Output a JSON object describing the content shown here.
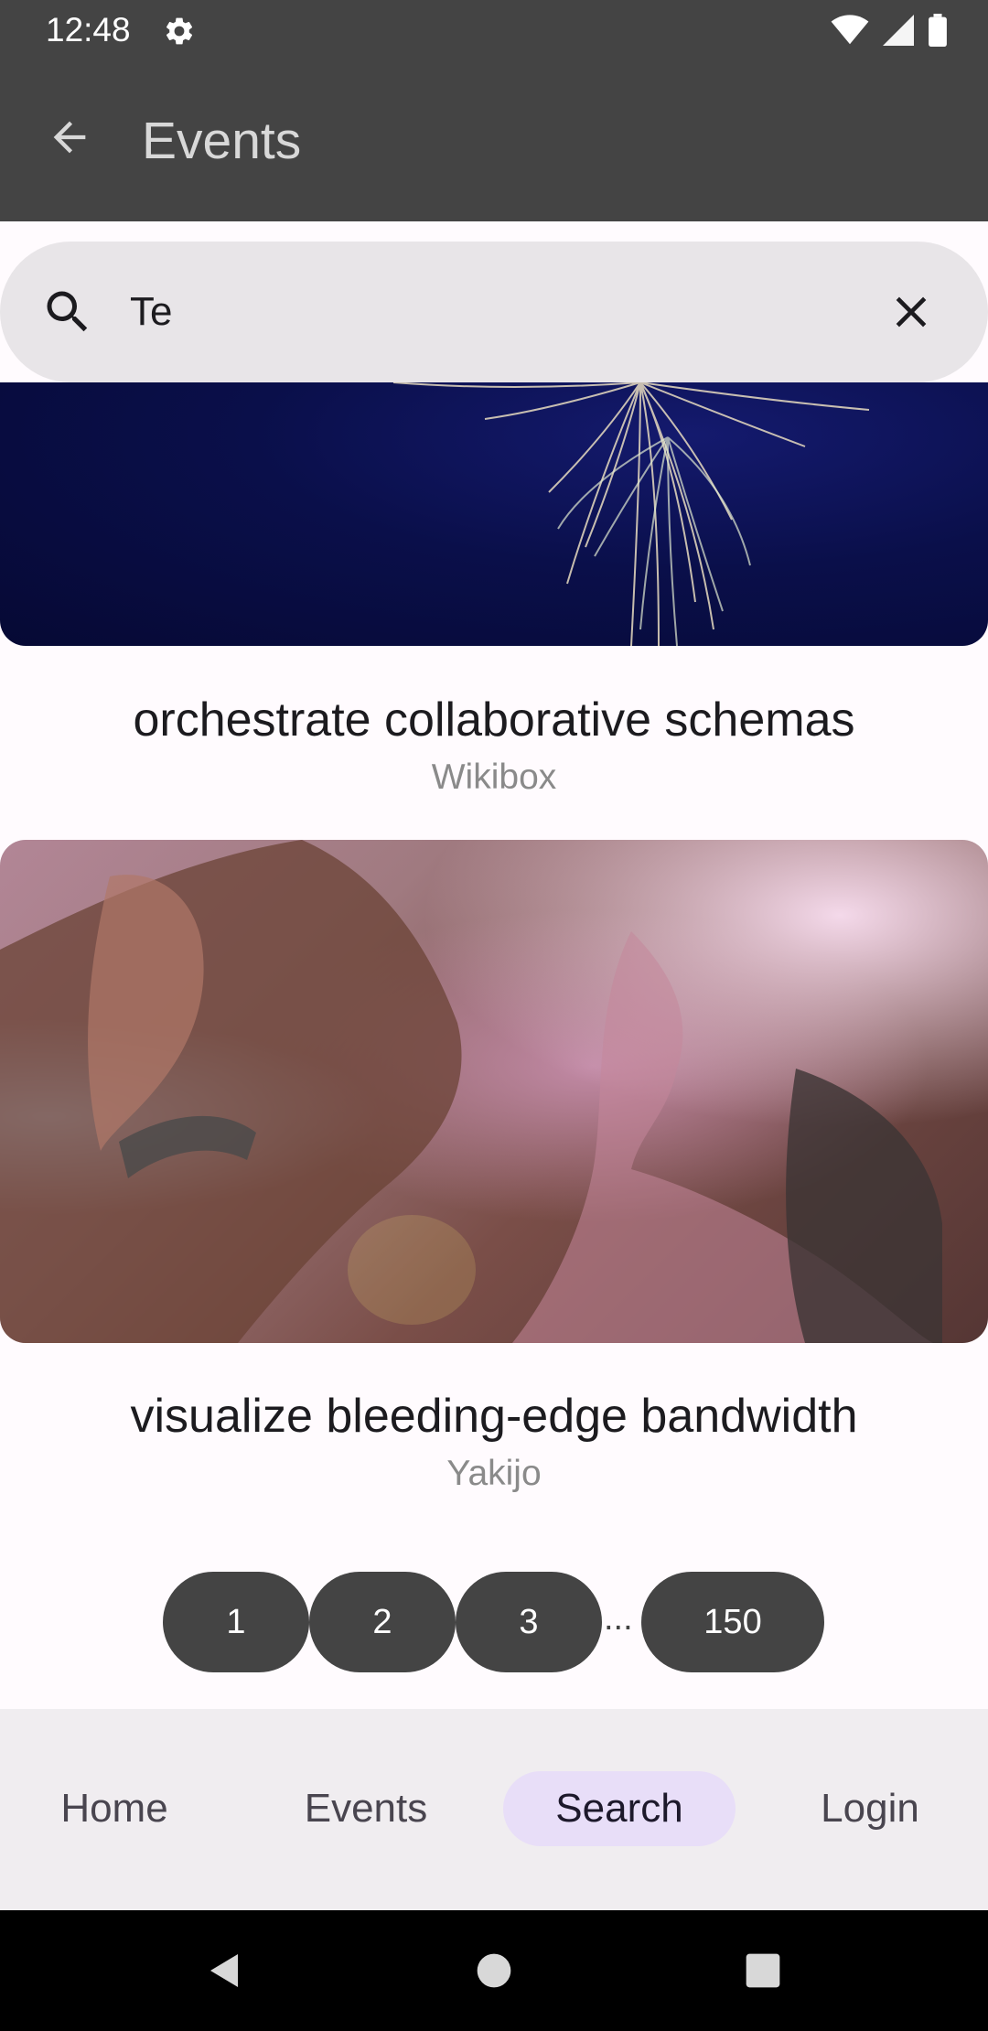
{
  "status_bar": {
    "time": "12:48",
    "icons": [
      "gear-icon",
      "wifi-icon",
      "signal-icon",
      "battery-icon"
    ]
  },
  "app_bar": {
    "title": "Events",
    "background": "#444444"
  },
  "search": {
    "value": "Te",
    "placeholder": ""
  },
  "results": [
    {
      "title": "orchestrate collaborative schemas",
      "organizer": "Wikibox",
      "image": "fireworks-photo"
    },
    {
      "title": "visualize bleeding-edge bandwidth",
      "organizer": "Yakijo",
      "image": "woman-portrait-photo"
    }
  ],
  "pagination": {
    "pages": [
      "1",
      "2",
      "3",
      "150"
    ],
    "ellipsis": "..."
  },
  "bottom_nav": {
    "items": [
      {
        "label": "Home",
        "active": false
      },
      {
        "label": "Events",
        "active": false
      },
      {
        "label": "Search",
        "active": true
      },
      {
        "label": "Login",
        "active": false
      }
    ],
    "active_color": "#e8def8"
  },
  "system_nav": {
    "icons": [
      "back-triangle-icon",
      "home-circle-icon",
      "recents-square-icon"
    ]
  }
}
